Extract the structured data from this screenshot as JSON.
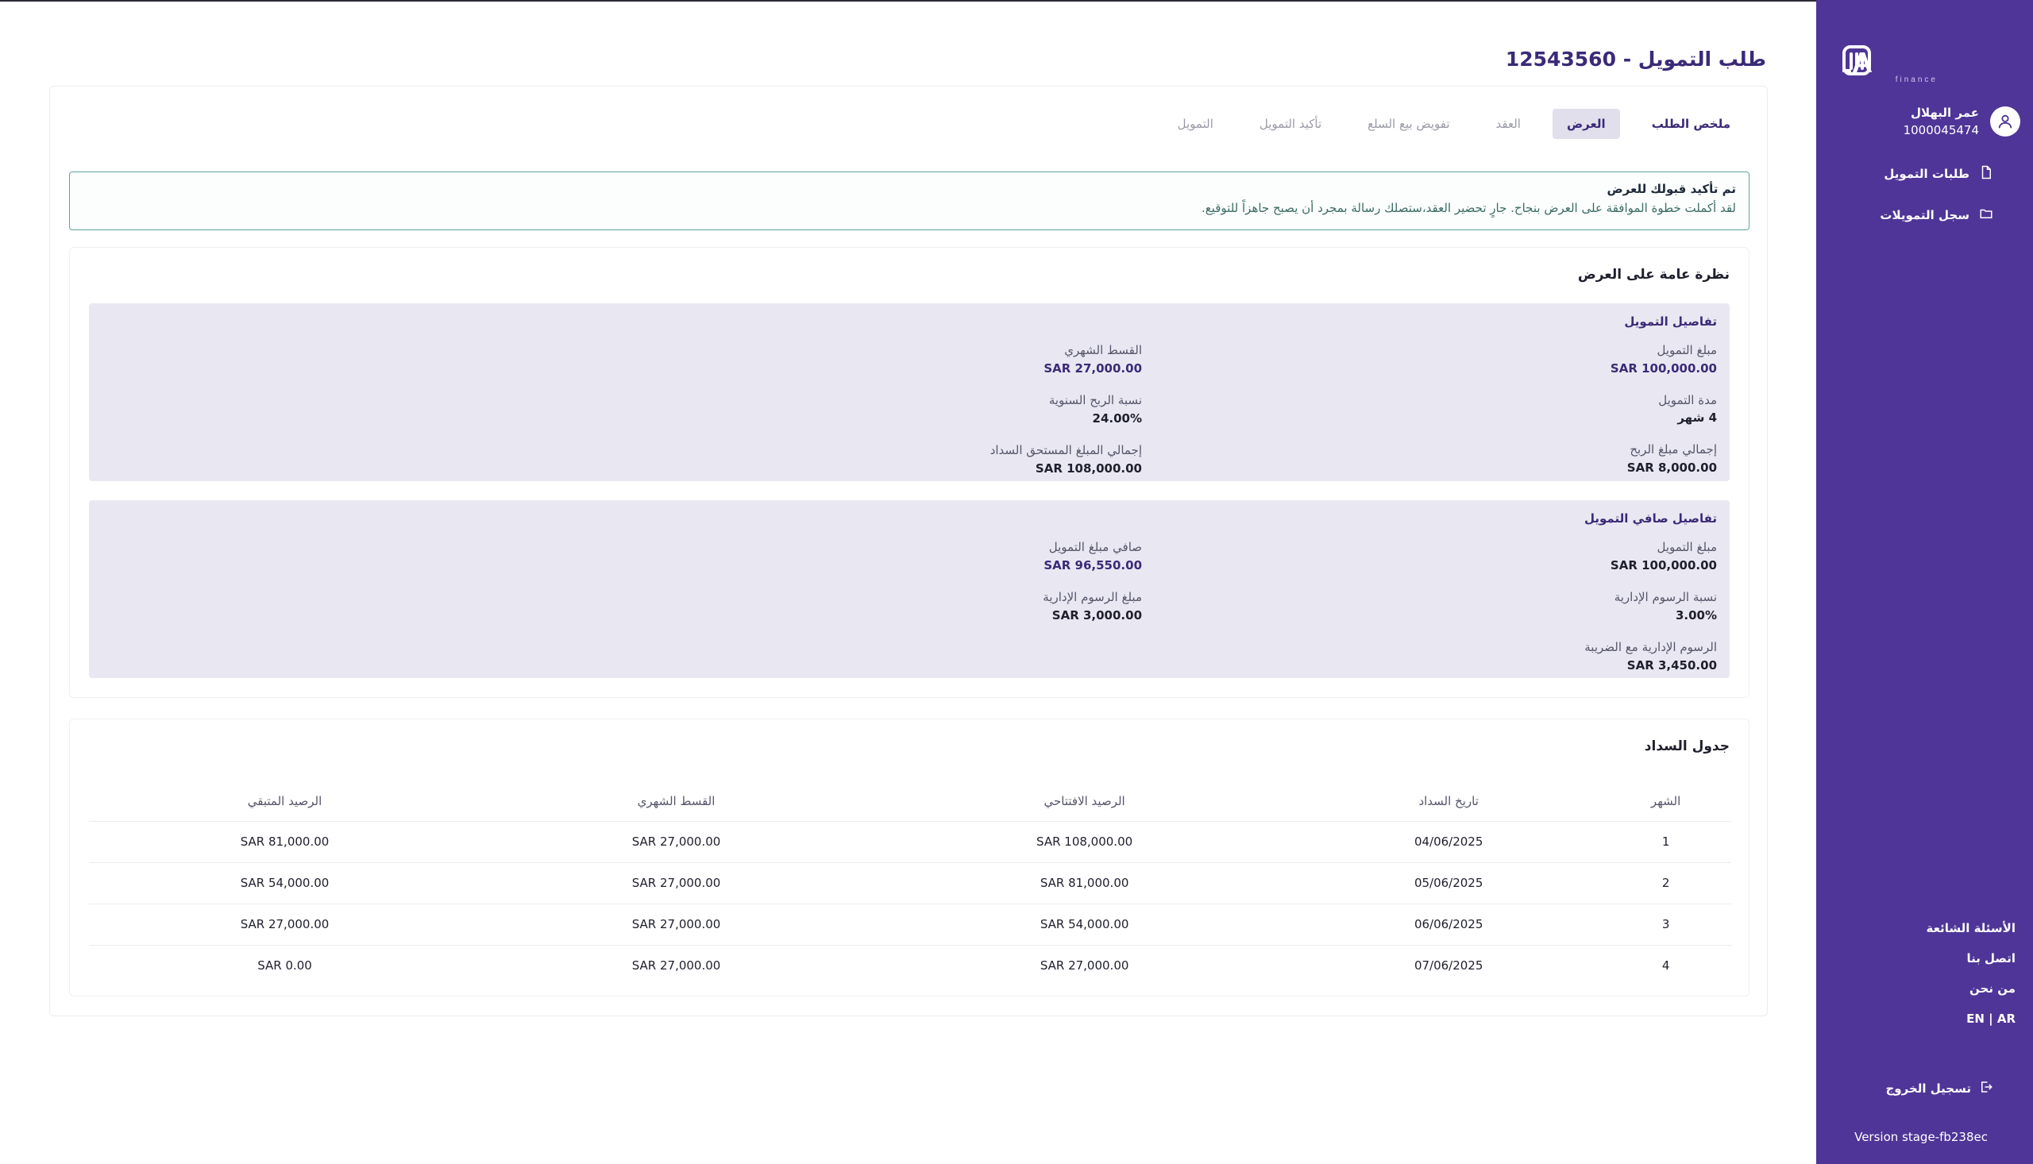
{
  "app": {
    "brand": "NAYLA",
    "brand_sub": "finance"
  },
  "page": {
    "title": "طلب التمويل - 12543560"
  },
  "sidebar": {
    "user_name": "عمر البهلال",
    "user_id": "1000045474",
    "nav": [
      {
        "label": "طلبات التمويل",
        "icon": "document-icon"
      },
      {
        "label": "سجل التمويلات",
        "icon": "folder-icon"
      }
    ],
    "links": {
      "faq": "الأسئلة الشائعة",
      "contact": "اتصل بنا",
      "about": "من نحن",
      "lang": "EN | AR"
    },
    "logout": "تسجيل الخروج",
    "version": "Version stage-fb238ec"
  },
  "tabs": [
    {
      "label": "ملخص الطلب",
      "state": "visited"
    },
    {
      "label": "العرض",
      "state": "current"
    },
    {
      "label": "العقد",
      "state": "disabled"
    },
    {
      "label": "تفويض بيع السلع",
      "state": "disabled"
    },
    {
      "label": "تأكيد التمويل",
      "state": "disabled"
    },
    {
      "label": "التمويل",
      "state": "disabled"
    }
  ],
  "alert": {
    "title": "تم تأكيد قبولك للعرض",
    "text": "لقد أكملت خطوة الموافقة على العرض بنجاح. جارٍ تحضير العقد،ستصلك رسالة بمجرد أن يصبح جاهزاً للتوقيع."
  },
  "overview": {
    "title": "نظرة عامة على العرض",
    "financing": {
      "title": "تفاصيل التمويل",
      "amount_label": "مبلغ التمويل",
      "amount": "SAR 100,000.00",
      "duration_label": "مدة التمويل",
      "duration": "4 شهر",
      "total_profit_label": "إجمالي مبلغ الربح",
      "total_profit": "SAR 8,000.00",
      "monthly_label": "القسط الشهري",
      "monthly": "SAR 27,000.00",
      "rate_label": "نسبة الربح السنوية",
      "rate": "24.00%",
      "total_due_label": "إجمالي المبلغ المستحق السداد",
      "total_due": "SAR 108,000.00"
    },
    "net": {
      "title": "تفاصيل صافي التمويل",
      "amount_label": "مبلغ التمويل",
      "amount": "SAR 100,000.00",
      "fee_rate_label": "نسبة الرسوم الإدارية",
      "fee_rate": "3.00%",
      "fee_tax_label": "الرسوم الإدارية مع الضريبة",
      "fee_tax": "SAR 3,450.00",
      "net_label": "صافي مبلغ التمويل",
      "net": "SAR 96,550.00",
      "fee_label": "مبلغ الرسوم الإدارية",
      "fee": "SAR 3,000.00"
    }
  },
  "schedule": {
    "title": "جدول السداد",
    "headers": [
      "الشهر",
      "تاريخ السداد",
      "الرصيد الافتتاحي",
      "القسط الشهري",
      "الرصيد المتبقي"
    ],
    "rows": [
      [
        "1",
        "04/06/2025",
        "SAR 108,000.00",
        "SAR 27,000.00",
        "SAR 81,000.00"
      ],
      [
        "2",
        "05/06/2025",
        "SAR 81,000.00",
        "SAR 27,000.00",
        "SAR 54,000.00"
      ],
      [
        "3",
        "06/06/2025",
        "SAR 54,000.00",
        "SAR 27,000.00",
        "SAR 27,000.00"
      ],
      [
        "4",
        "07/06/2025",
        "SAR 27,000.00",
        "SAR 27,000.00",
        "SAR 0.00"
      ]
    ]
  },
  "colors": {
    "sidebar": "#4f3597",
    "accent": "#3b2a78",
    "panel": "#e9e8f2",
    "alert_border": "#5da59a"
  }
}
